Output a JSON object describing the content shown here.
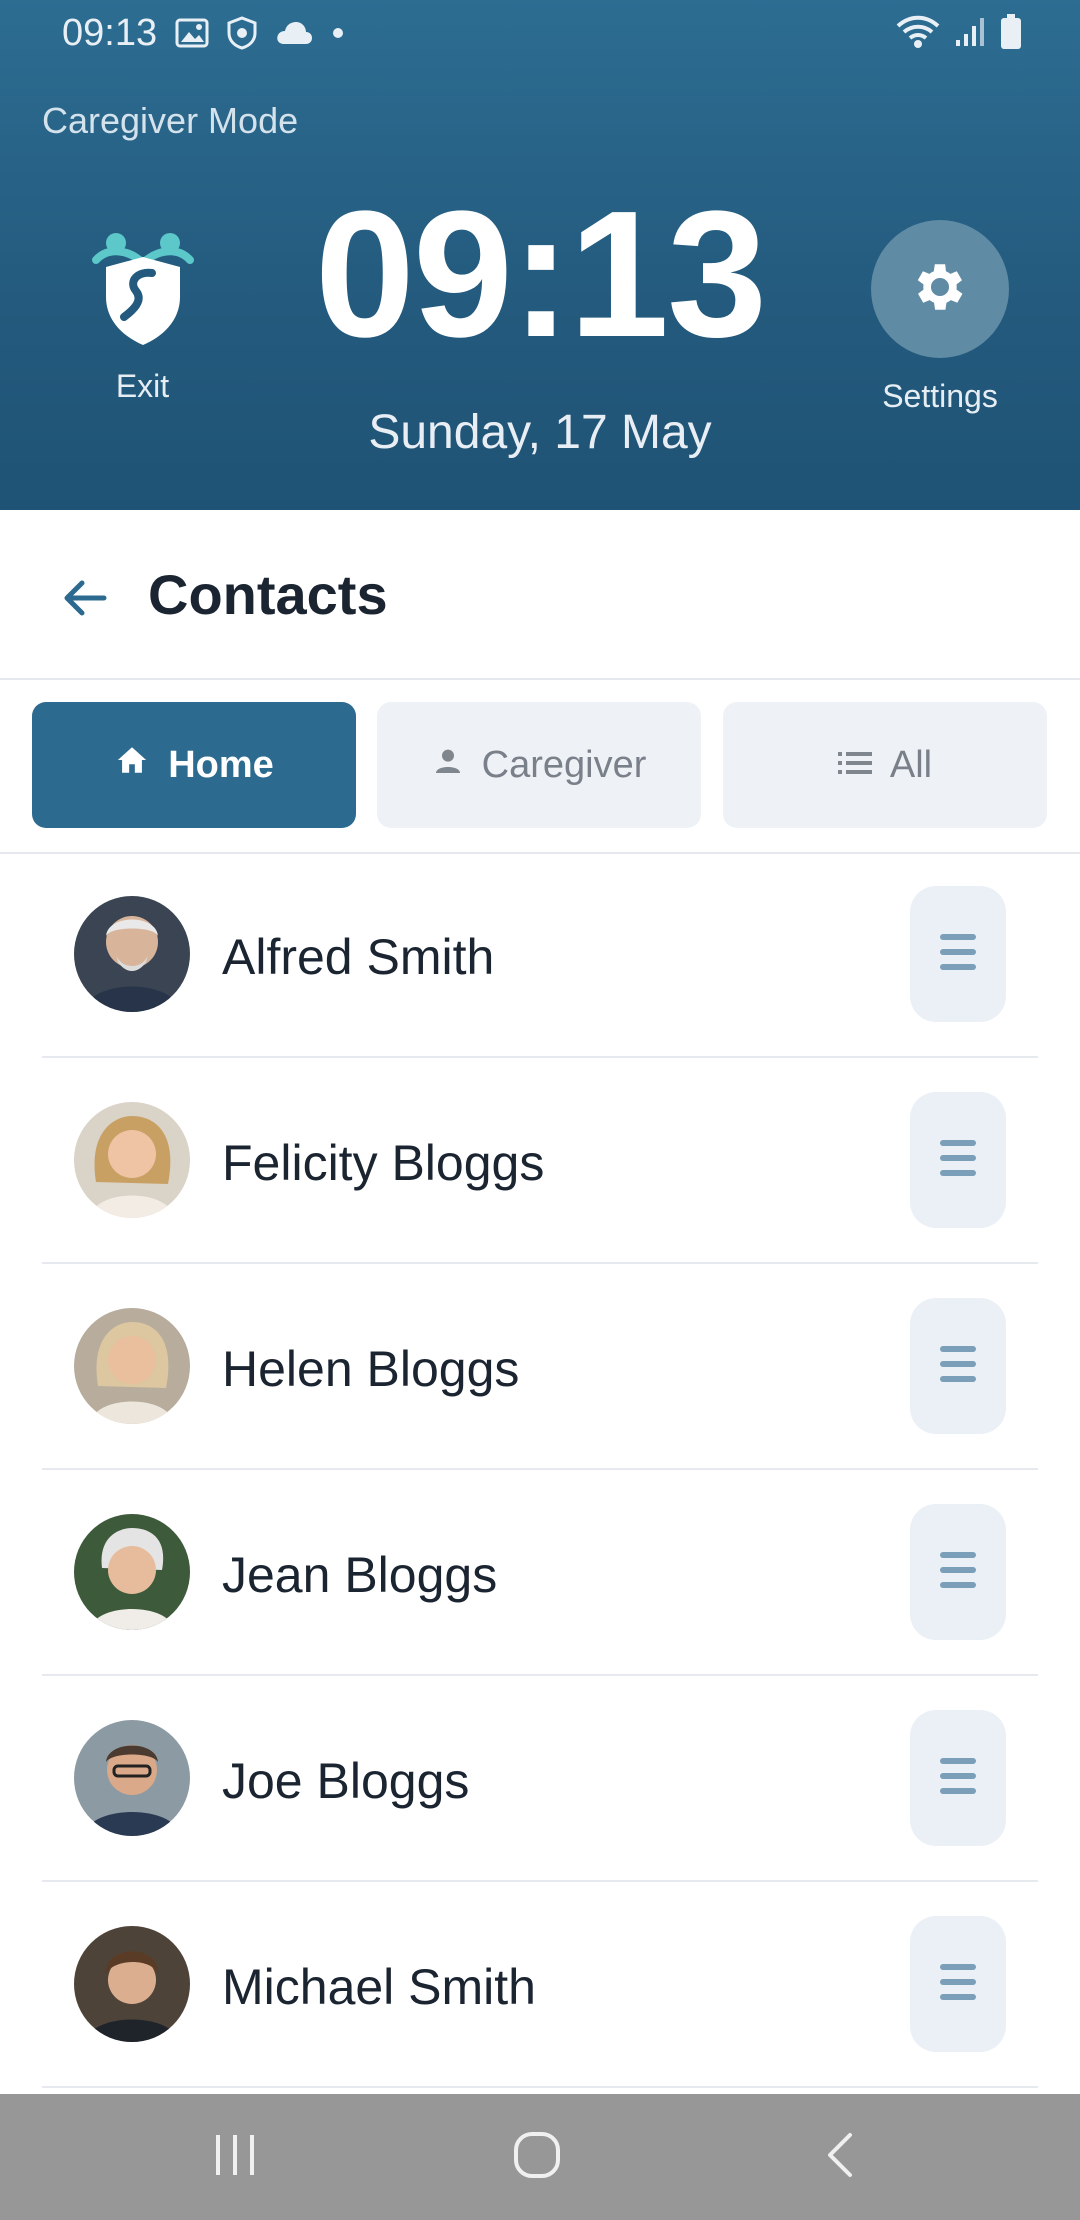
{
  "status_bar": {
    "time": "09:13",
    "left_icons": [
      "image-icon",
      "shield-icon",
      "cloud-icon",
      "dot-icon"
    ],
    "right_icons": [
      "wifi-icon",
      "signal-icon",
      "battery-icon"
    ]
  },
  "header": {
    "mode_label": "Caregiver Mode",
    "clock": "09:13",
    "date": "Sunday, 17 May",
    "exit_label": "Exit",
    "settings_label": "Settings",
    "brand_color": "#2c6a90"
  },
  "page": {
    "title": "Contacts"
  },
  "tabs": [
    {
      "label": "Home",
      "icon": "home-icon",
      "active": true
    },
    {
      "label": "Caregiver",
      "icon": "person-icon",
      "active": false
    },
    {
      "label": "All",
      "icon": "list-icon",
      "active": false
    }
  ],
  "contacts": [
    {
      "name": "Alfred Smith"
    },
    {
      "name": "Felicity Bloggs"
    },
    {
      "name": "Helen Bloggs"
    },
    {
      "name": "Jean Bloggs"
    },
    {
      "name": "Joe Bloggs"
    },
    {
      "name": "Michael Smith"
    }
  ],
  "navbar": {
    "buttons": [
      "recents-icon",
      "home-circle-icon",
      "back-chevron-icon"
    ]
  }
}
